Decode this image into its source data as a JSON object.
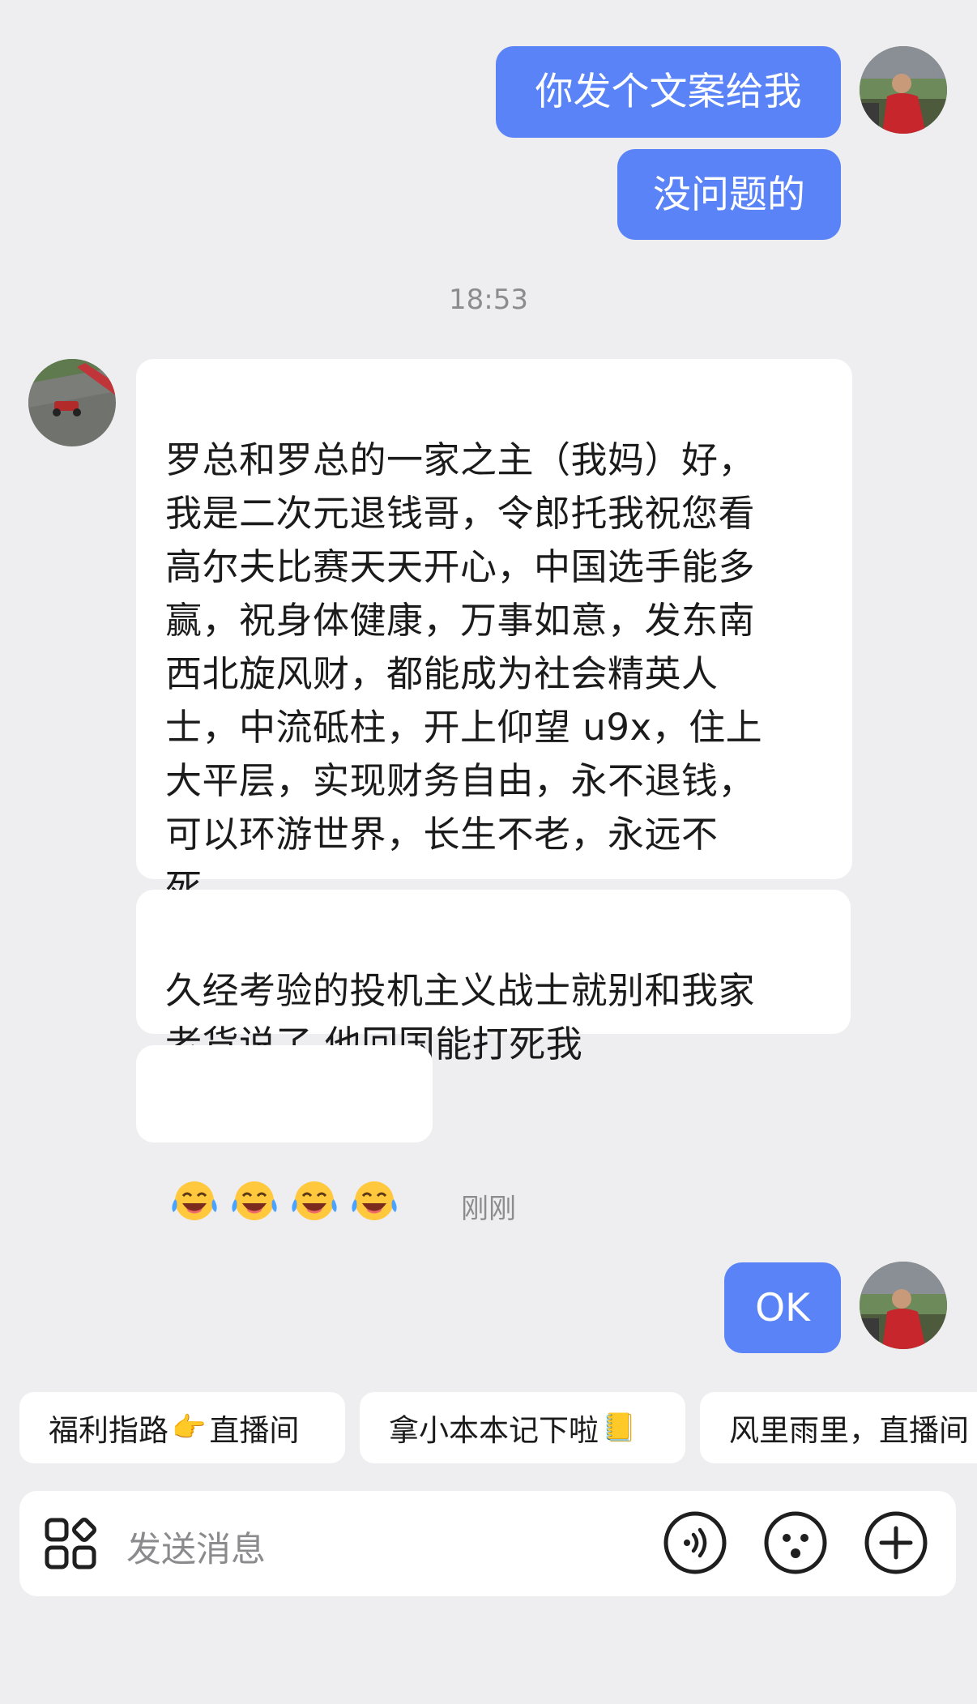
{
  "messages": {
    "out1": "你发个文案给我",
    "out2": "没问题的",
    "time1": "18:53",
    "in1": "罗总和罗总的一家之主（我妈）好，\n我是二次元退钱哥，令郎托我祝您看\n高尔夫比赛天天开心，中国选手能多\n赢，祝身体健康，万事如意，发东南\n西北旋风财，都能成为社会精英人\n士，中流砥柱，开上仰望 u9x，住上\n大平层，实现财务自由，永不退钱，\n可以环游世界，长生不老，永远不\n死。",
    "in2": "久经考验的投机主义战士就别和我家\n老货说了 他回国能打死我",
    "in3_emoji": "😂😂😂😂",
    "time2": "刚刚",
    "out3": "OK"
  },
  "quick_replies": [
    {
      "text": "福利指路",
      "emoji": "👉",
      "suffix": "直播间"
    },
    {
      "text": "拿小本本记下啦",
      "emoji": "📒",
      "suffix": ""
    },
    {
      "text": "风里雨里，直播间",
      "emoji": "",
      "suffix": ""
    }
  ],
  "input": {
    "placeholder": "发送消息"
  },
  "colors": {
    "outgoing_bubble": "#5a83f7",
    "incoming_bubble": "#ffffff",
    "background": "#eeeef0"
  },
  "icons": [
    "apps-icon",
    "voice-icon",
    "emoji-icon",
    "plus-icon"
  ]
}
